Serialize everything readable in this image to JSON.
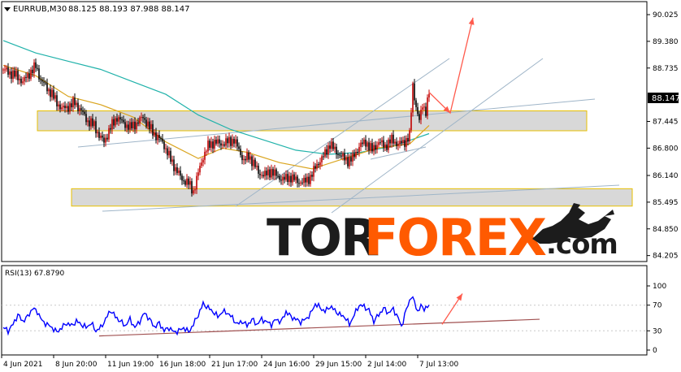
{
  "header": {
    "symbol": "EURRUB,M30",
    "ohlc": "88.125 88.193 87.988 88.147",
    "menu_icon": "triangle-down-icon"
  },
  "current_price_label": "88.147",
  "rsi": {
    "label": "RSI(13) 67.8790",
    "levels": [
      "100",
      "70",
      "30",
      "0"
    ]
  },
  "watermark": {
    "part1": "TOR",
    "part2": "FOREX",
    "part3": ".com",
    "icon": "bull-bear-icon"
  },
  "colors": {
    "background": "#ffffff",
    "bull_candle": "#c00000",
    "bear_candle": "#000000",
    "ma_fast": "#daa520",
    "ma_slow": "#20b2aa",
    "trend_line": "#9fb5c8",
    "zone_fill": "#d8d8d8",
    "zone_border": "#e8c000",
    "forecast_arrow": "#ff5b4d",
    "rsi_line": "#0000ff",
    "rsi_trend": "#a05050",
    "watermark_dark": "#1c1c1c",
    "watermark_orange": "#ff5a00"
  },
  "chart_data": [
    {
      "type": "candlestick",
      "title": "EURRUB,M30",
      "y_ticks": [
        "90.025",
        "89.380",
        "88.735",
        "88.147",
        "87.445",
        "86.800",
        "86.140",
        "85.495",
        "84.850",
        "84.205"
      ],
      "y_range": [
        84.1,
        90.3
      ],
      "x_ticks": [
        "4 Jun 2021",
        "8 Jun 20:00",
        "11 Jun 19:00",
        "16 Jun 18:00",
        "21 Jun 17:00",
        "24 Jun 16:00",
        "29 Jun 15:00",
        "2 Jul 14:00",
        "7 Jul 13:00"
      ],
      "close_path": [
        [
          0,
          88.7
        ],
        [
          8,
          88.62
        ],
        [
          16,
          88.55
        ],
        [
          24,
          88.4
        ],
        [
          32,
          88.6
        ],
        [
          40,
          88.78
        ],
        [
          46,
          88.45
        ],
        [
          52,
          88.3
        ],
        [
          60,
          88.1
        ],
        [
          66,
          87.9
        ],
        [
          72,
          87.75
        ],
        [
          80,
          87.8
        ],
        [
          88,
          87.9
        ],
        [
          96,
          87.7
        ],
        [
          104,
          87.45
        ],
        [
          112,
          87.35
        ],
        [
          118,
          87.1
        ],
        [
          124,
          86.95
        ],
        [
          132,
          87.3
        ],
        [
          140,
          87.55
        ],
        [
          148,
          87.4
        ],
        [
          156,
          87.3
        ],
        [
          164,
          87.4
        ],
        [
          172,
          87.55
        ],
        [
          180,
          87.3
        ],
        [
          188,
          87.1
        ],
        [
          196,
          86.95
        ],
        [
          204,
          86.6
        ],
        [
          212,
          86.3
        ],
        [
          220,
          86.05
        ],
        [
          228,
          85.95
        ],
        [
          234,
          85.75
        ],
        [
          240,
          86.2
        ],
        [
          246,
          86.6
        ],
        [
          252,
          86.85
        ],
        [
          260,
          86.95
        ],
        [
          268,
          86.9
        ],
        [
          276,
          86.95
        ],
        [
          284,
          87.0
        ],
        [
          290,
          86.75
        ],
        [
          296,
          86.5
        ],
        [
          302,
          86.6
        ],
        [
          308,
          86.45
        ],
        [
          314,
          86.2
        ],
        [
          322,
          86.15
        ],
        [
          330,
          86.25
        ],
        [
          338,
          86.1
        ],
        [
          346,
          86.05
        ],
        [
          354,
          86.1
        ],
        [
          362,
          86.0
        ],
        [
          370,
          85.98
        ],
        [
          378,
          86.1
        ],
        [
          386,
          86.4
        ],
        [
          394,
          86.6
        ],
        [
          402,
          86.9
        ],
        [
          408,
          86.75
        ],
        [
          416,
          86.6
        ],
        [
          424,
          86.5
        ],
        [
          430,
          86.55
        ],
        [
          438,
          86.85
        ],
        [
          446,
          86.95
        ],
        [
          454,
          86.75
        ],
        [
          462,
          86.95
        ],
        [
          470,
          86.85
        ],
        [
          478,
          87.0
        ],
        [
          486,
          86.9
        ],
        [
          494,
          86.95
        ],
        [
          500,
          87.1
        ],
        [
          504,
          88.3
        ],
        [
          508,
          87.8
        ],
        [
          512,
          87.45
        ],
        [
          516,
          87.85
        ],
        [
          520,
          87.7
        ],
        [
          524,
          88.15
        ]
      ],
      "ma_fast": [
        [
          0,
          88.8
        ],
        [
          40,
          88.55
        ],
        [
          80,
          88.05
        ],
        [
          120,
          87.85
        ],
        [
          160,
          87.55
        ],
        [
          200,
          86.95
        ],
        [
          240,
          86.55
        ],
        [
          270,
          86.8
        ],
        [
          300,
          86.7
        ],
        [
          340,
          86.45
        ],
        [
          380,
          86.3
        ],
        [
          420,
          86.55
        ],
        [
          460,
          86.8
        ],
        [
          500,
          86.9
        ],
        [
          524,
          87.35
        ]
      ],
      "ma_slow": [
        [
          0,
          89.4
        ],
        [
          40,
          89.1
        ],
        [
          80,
          88.9
        ],
        [
          120,
          88.7
        ],
        [
          160,
          88.4
        ],
        [
          200,
          88.1
        ],
        [
          240,
          87.6
        ],
        [
          280,
          87.25
        ],
        [
          320,
          87.0
        ],
        [
          360,
          86.75
        ],
        [
          400,
          86.65
        ],
        [
          440,
          86.7
        ],
        [
          480,
          86.85
        ],
        [
          524,
          87.15
        ]
      ],
      "support_zones": [
        {
          "from": 87.22,
          "to": 87.7
        },
        {
          "from": 85.4,
          "to": 85.82
        }
      ],
      "forecast": [
        [
          524,
          88.15
        ],
        [
          550,
          87.65
        ],
        [
          578,
          89.95
        ]
      ]
    },
    {
      "type": "line",
      "title": "RSI(13) 67.8790",
      "y_ticks": [
        "100",
        "70",
        "30",
        "0"
      ],
      "y_range": [
        0,
        100
      ],
      "current_value": 67.879,
      "rsi_path": [
        [
          0,
          35
        ],
        [
          6,
          30
        ],
        [
          12,
          40
        ],
        [
          18,
          55
        ],
        [
          24,
          45
        ],
        [
          30,
          52
        ],
        [
          36,
          65
        ],
        [
          42,
          60
        ],
        [
          48,
          45
        ],
        [
          54,
          40
        ],
        [
          60,
          35
        ],
        [
          66,
          28
        ],
        [
          72,
          35
        ],
        [
          78,
          42
        ],
        [
          84,
          38
        ],
        [
          90,
          45
        ],
        [
          96,
          40
        ],
        [
          102,
          35
        ],
        [
          108,
          42
        ],
        [
          114,
          30
        ],
        [
          120,
          35
        ],
        [
          126,
          48
        ],
        [
          132,
          62
        ],
        [
          138,
          52
        ],
        [
          144,
          45
        ],
        [
          150,
          38
        ],
        [
          156,
          48
        ],
        [
          162,
          35
        ],
        [
          168,
          45
        ],
        [
          174,
          58
        ],
        [
          180,
          48
        ],
        [
          186,
          36
        ],
        [
          192,
          42
        ],
        [
          198,
          30
        ],
        [
          204,
          35
        ],
        [
          210,
          28
        ],
        [
          216,
          30
        ],
        [
          222,
          35
        ],
        [
          228,
          28
        ],
        [
          234,
          40
        ],
        [
          240,
          55
        ],
        [
          246,
          72
        ],
        [
          252,
          66
        ],
        [
          258,
          60
        ],
        [
          264,
          52
        ],
        [
          270,
          60
        ],
        [
          276,
          58
        ],
        [
          282,
          50
        ],
        [
          288,
          40
        ],
        [
          294,
          45
        ],
        [
          300,
          38
        ],
        [
          306,
          48
        ],
        [
          312,
          40
        ],
        [
          318,
          48
        ],
        [
          324,
          44
        ],
        [
          330,
          40
        ],
        [
          336,
          48
        ],
        [
          342,
          44
        ],
        [
          348,
          60
        ],
        [
          354,
          52
        ],
        [
          360,
          48
        ],
        [
          366,
          44
        ],
        [
          372,
          48
        ],
        [
          378,
          56
        ],
        [
          384,
          72
        ],
        [
          390,
          66
        ],
        [
          396,
          60
        ],
        [
          402,
          68
        ],
        [
          408,
          62
        ],
        [
          414,
          55
        ],
        [
          420,
          52
        ],
        [
          426,
          40
        ],
        [
          432,
          55
        ],
        [
          438,
          70
        ],
        [
          444,
          68
        ],
        [
          450,
          62
        ],
        [
          456,
          45
        ],
        [
          462,
          55
        ],
        [
          468,
          65
        ],
        [
          474,
          58
        ],
        [
          480,
          64
        ],
        [
          486,
          50
        ],
        [
          490,
          36
        ],
        [
          494,
          55
        ],
        [
          498,
          70
        ],
        [
          502,
          84
        ],
        [
          506,
          75
        ],
        [
          510,
          60
        ],
        [
          514,
          68
        ],
        [
          518,
          65
        ],
        [
          524,
          68
        ]
      ],
      "trend_line": [
        [
          118,
          22
        ],
        [
          660,
          48
        ]
      ],
      "forecast": [
        [
          540,
          40
        ],
        [
          565,
          88
        ]
      ]
    }
  ]
}
